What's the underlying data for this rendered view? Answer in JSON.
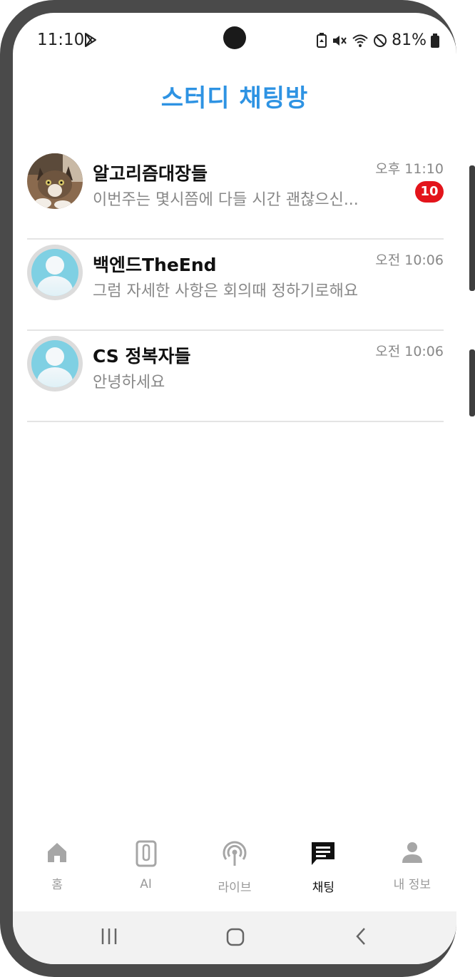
{
  "status_bar": {
    "time": "11:10",
    "battery": "81%",
    "icons": [
      "play-store-icon",
      "battery-saver-icon",
      "mute-icon",
      "wifi-icon",
      "dnd-icon",
      "battery-icon"
    ]
  },
  "header": {
    "title": "스터디 채팅방"
  },
  "chats": [
    {
      "name": "알고리즘대장들",
      "preview": "이번주는 몇시쯤에 다들 시간 괜찮으신...",
      "time": "오후 11:10",
      "unread": "10",
      "avatar": "cat-photo"
    },
    {
      "name": "백엔드TheEnd",
      "preview": "그럼 자세한 사항은 회의때 정하기로해요",
      "time": "오전 10:06",
      "avatar": "default-user"
    },
    {
      "name": "CS 정복자들",
      "preview": "안녕하세요",
      "time": "오전 10:06",
      "avatar": "default-user"
    }
  ],
  "nav": {
    "items": [
      {
        "label": "홈",
        "icon": "home-icon"
      },
      {
        "label": "AI",
        "icon": "clip-icon"
      },
      {
        "label": "라이브",
        "icon": "broadcast-icon"
      },
      {
        "label": "채팅",
        "icon": "chat-icon",
        "active": true
      },
      {
        "label": "내 정보",
        "icon": "person-icon"
      }
    ]
  },
  "colors": {
    "accent": "#2e93e3",
    "badge": "#e3141b",
    "inactive": "#9a9a9a",
    "active": "#111111"
  }
}
